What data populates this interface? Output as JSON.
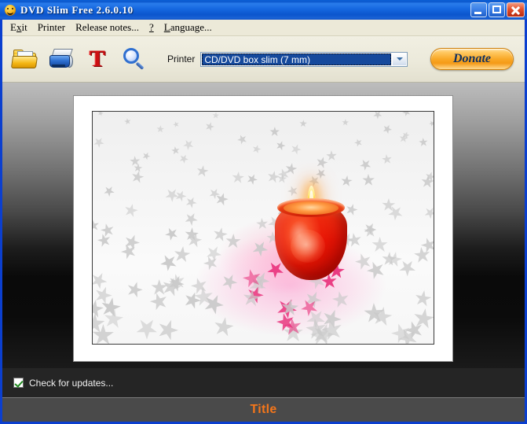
{
  "window": {
    "title": "DVD Slim Free 2.6.0.10",
    "app_icon": "smiley-face-icon",
    "controls": {
      "minimize": "minimize-icon",
      "maximize": "maximize-icon",
      "close": "close-icon"
    },
    "border_color": "#0b3fcf",
    "titlebar_color": "#1668e0"
  },
  "menu": {
    "items": [
      {
        "label": "Exit",
        "accel_index": 1
      },
      {
        "label": "Printer",
        "accel_index": -1
      },
      {
        "label": "Release notes...",
        "accel_index": -1
      },
      {
        "label": "?",
        "accel_index": -1
      },
      {
        "label": "Language...",
        "accel_index": 0
      }
    ]
  },
  "toolbar": {
    "background_color": "#eceadb",
    "buttons": [
      {
        "name": "open-folder",
        "icon": "folder-open-icon",
        "tooltip": "Open"
      },
      {
        "name": "print",
        "icon": "printer-icon",
        "tooltip": "Print"
      },
      {
        "name": "text",
        "icon": "text-t-icon",
        "tooltip": "Text"
      },
      {
        "name": "preview",
        "icon": "magnifier-icon",
        "tooltip": "Preview"
      }
    ],
    "printer": {
      "label": "Printer",
      "selected": "CD/DVD box slim (7 mm)",
      "placeholder": "CD/DVD box slim (7 mm)",
      "options": [
        "CD/DVD box slim (7 mm)"
      ],
      "selected_bg": "#15499c",
      "selected_fg": "#ffffff"
    },
    "donate": {
      "label": "Donate",
      "color": "#f9a827",
      "text_color": "#10305f"
    }
  },
  "workspace": {
    "background": "gradient gray to black",
    "preview": {
      "card_color": "#ffffff",
      "photo": {
        "name": "candle-photo",
        "description": "Red glass candle holder with lit flame on white surface scattered with silver star confetti and pink stars",
        "glow_color": "#ff78be",
        "candle_color": "#e81505",
        "flame_color": "#ffc328",
        "star_color": "#c9c9c9",
        "pink_star_color": "#e8307a"
      }
    }
  },
  "updates": {
    "label": "Check for updates...",
    "checked": true,
    "check_color": "#1f8a1f"
  },
  "statusbar": {
    "text": "Title",
    "text_color": "#f5761a",
    "background_color": "#4a4a4a"
  }
}
